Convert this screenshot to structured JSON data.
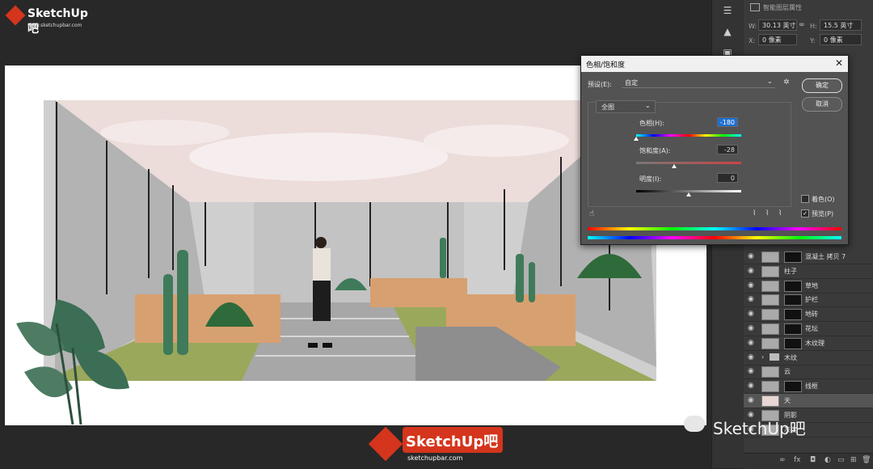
{
  "watermark": {
    "brand": "SketchUp吧",
    "url": "www.sketchupbar.com"
  },
  "properties_panel": {
    "header": "智能图层属性",
    "w_label": "W:",
    "w_value": "30.13 英寸",
    "h_label": "H:",
    "h_value": "15.5 英寸",
    "x_label": "X:",
    "x_value": "0 像素",
    "y_label": "Y:",
    "y_value": "0 像素"
  },
  "dialog": {
    "title": "色相/饱和度",
    "preset_label": "预设(E):",
    "preset_value": "自定",
    "ok_label": "确定",
    "cancel_label": "取消",
    "channel_value": "全图",
    "hue_label": "色相(H):",
    "hue_value": "-180",
    "saturation_label": "饱和度(A):",
    "saturation_value": "-28",
    "lightness_label": "明度(I):",
    "lightness_value": "0",
    "colorize_label": "着色(O)",
    "preview_label": "预览(P)",
    "preview_checked": true,
    "colorize_checked": false
  },
  "sliders": {
    "hue": -180,
    "saturation": -28,
    "lightness": 0
  },
  "layers": [
    {
      "name": "混凝土 拷贝 7",
      "has_mask": true
    },
    {
      "name": "柱子",
      "has_mask": false
    },
    {
      "name": "草地",
      "has_mask": true
    },
    {
      "name": "护栏",
      "has_mask": true
    },
    {
      "name": "地砖",
      "has_mask": true
    },
    {
      "name": "花坛",
      "has_mask": true
    },
    {
      "name": "木纹理",
      "has_mask": true
    },
    {
      "name": "木纹",
      "has_mask": false,
      "is_group": true
    },
    {
      "name": "云",
      "has_mask": false
    },
    {
      "name": "线框",
      "has_mask": true
    },
    {
      "name": "天",
      "has_mask": false,
      "selected": true
    },
    {
      "name": "阴影",
      "has_mask": false
    },
    {
      "name": "灰度",
      "has_mask": false
    }
  ],
  "bottom_logo": {
    "brand": "SketchUp吧",
    "url": "sketchupbar.com"
  },
  "wechat_badge": {
    "text": "SketchUp吧"
  },
  "colors": {
    "accent": "#1e6fd0",
    "brand_red": "#d4351c",
    "sky": "#e8d6d4",
    "concrete": "#b9b9b9",
    "wood": "#d29a6a",
    "grass": "#6a9a3a"
  }
}
